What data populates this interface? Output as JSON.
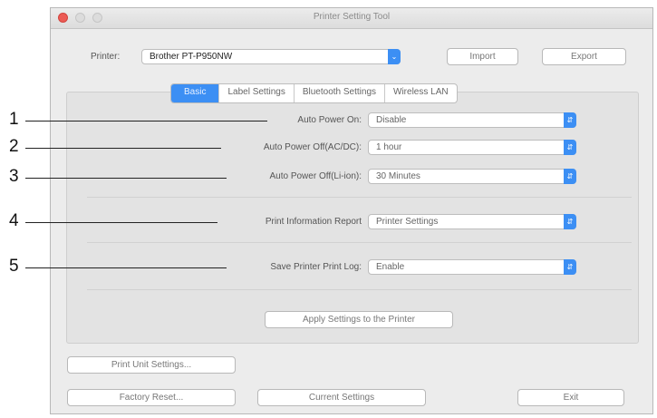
{
  "window": {
    "title": "Printer Setting Tool"
  },
  "printer": {
    "label": "Printer:",
    "value": "Brother PT-P950NW"
  },
  "header_buttons": {
    "import": "Import",
    "export": "Export"
  },
  "tabs": [
    {
      "label": "Basic",
      "active": true
    },
    {
      "label": "Label Settings",
      "active": false
    },
    {
      "label": "Bluetooth Settings",
      "active": false
    },
    {
      "label": "Wireless LAN",
      "active": false
    }
  ],
  "settings": [
    {
      "label": "Auto Power On:",
      "value": "Disable"
    },
    {
      "label": "Auto Power Off(AC/DC):",
      "value": "1 hour"
    },
    {
      "label": "Auto Power Off(Li-ion):",
      "value": "30 Minutes"
    },
    {
      "label": "Print Information Report",
      "value": "Printer Settings"
    },
    {
      "label": "Save Printer Print Log:",
      "value": "Enable"
    }
  ],
  "apply_button": "Apply Settings to the Printer",
  "bottom_buttons": {
    "print_unit": "Print Unit Settings...",
    "factory_reset": "Factory Reset...",
    "current_settings": "Current Settings",
    "exit": "Exit"
  },
  "callouts": [
    "1",
    "2",
    "3",
    "4",
    "5"
  ],
  "colors": {
    "accent": "#3c8ff4",
    "close": "#ec5b55"
  }
}
